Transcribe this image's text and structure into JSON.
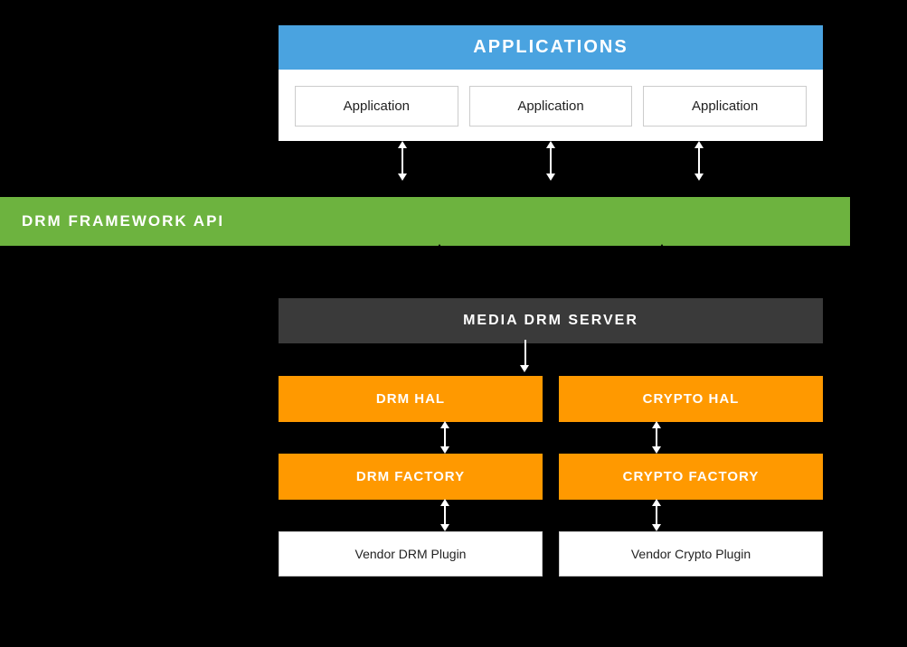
{
  "header": {
    "title": "APPLICATIONS"
  },
  "applications": [
    {
      "label": "Application"
    },
    {
      "label": "Application"
    },
    {
      "label": "Application"
    }
  ],
  "drm_framework": {
    "label": "DRM FRAMEWORK API"
  },
  "media_drm_server": {
    "label": "MEDIA DRM SERVER"
  },
  "hal_row": [
    {
      "label": "DRM HAL"
    },
    {
      "label": "CRYPTO HAL"
    }
  ],
  "factory_row": [
    {
      "label": "DRM FACTORY"
    },
    {
      "label": "CRYPTO FACTORY"
    }
  ],
  "vendor_row": [
    {
      "label": "Vendor DRM Plugin"
    },
    {
      "label": "Vendor Crypto Plugin"
    }
  ]
}
